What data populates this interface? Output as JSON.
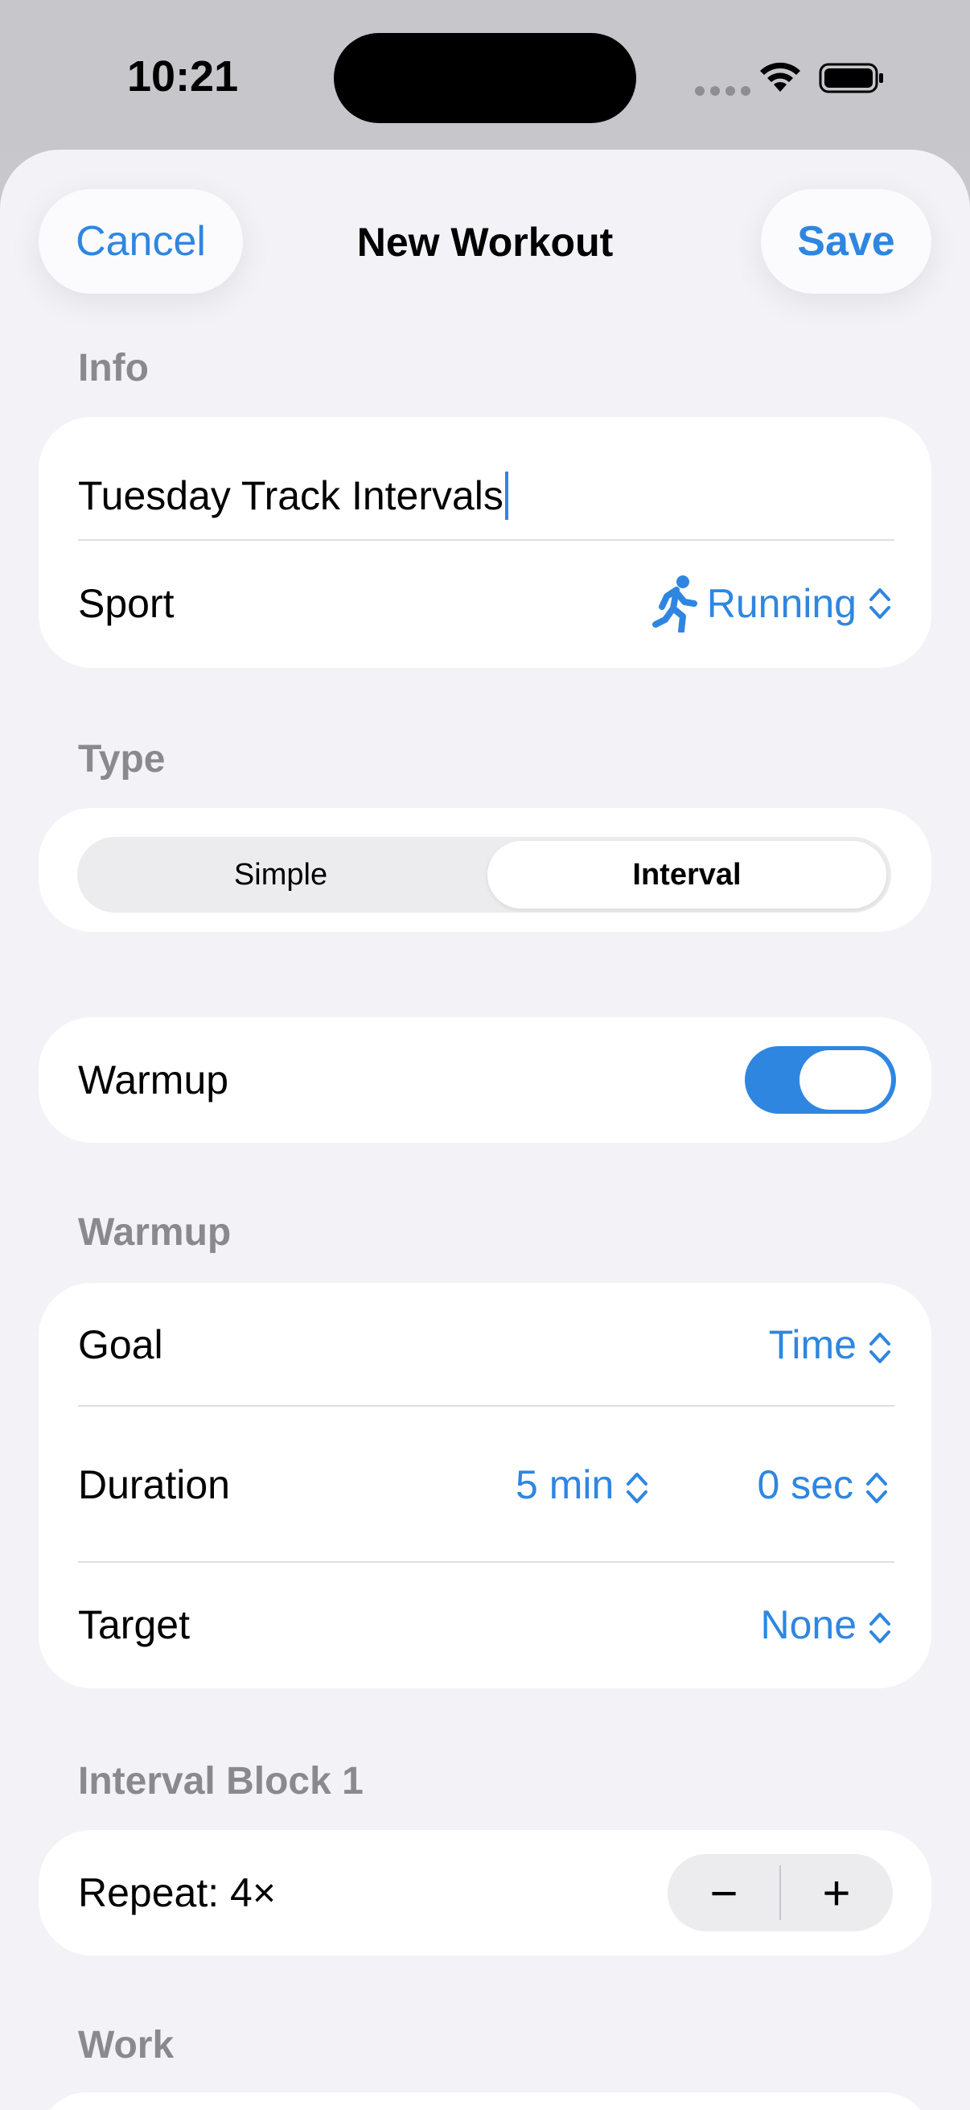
{
  "status_bar": {
    "time": "10:21"
  },
  "nav": {
    "cancel_label": "Cancel",
    "title": "New Workout",
    "save_label": "Save"
  },
  "info": {
    "header": "Info",
    "name_value": "Tuesday Track Intervals",
    "sport_label": "Sport",
    "sport_value": "Running",
    "sport_icon": "running-figure-icon"
  },
  "type": {
    "header": "Type",
    "options": [
      "Simple",
      "Interval"
    ],
    "selected": "Interval"
  },
  "warmup_toggle": {
    "label": "Warmup",
    "on": true
  },
  "warmup": {
    "header": "Warmup",
    "goal_label": "Goal",
    "goal_value": "Time",
    "duration_label": "Duration",
    "duration_min": "5 min",
    "duration_sec": "0 sec",
    "target_label": "Target",
    "target_value": "None"
  },
  "interval_block": {
    "header": "Interval Block 1",
    "repeat_label": "Repeat: 4×",
    "minus": "−",
    "plus": "+"
  },
  "work": {
    "header": "Work"
  },
  "colors": {
    "accent": "#2f86e0",
    "background": "#f2f2f7",
    "card": "#ffffff",
    "section_header": "#8a8a8e"
  }
}
